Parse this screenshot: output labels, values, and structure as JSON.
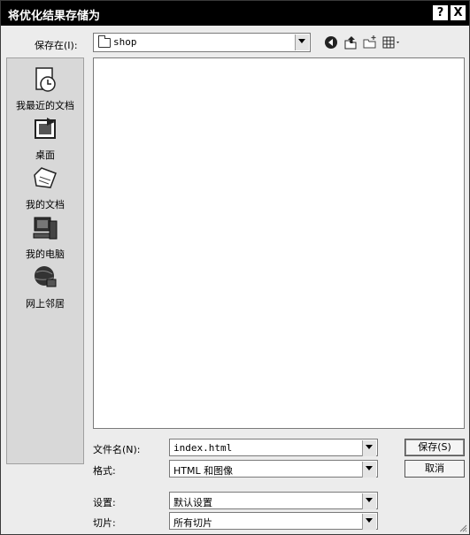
{
  "dialog": {
    "title": "将优化结果存储为",
    "help_button": "?",
    "close_button": "X"
  },
  "lookin": {
    "label": "保存在(I):",
    "value": "shop"
  },
  "toolbar": {
    "icons": [
      "back-icon",
      "up-folder-icon",
      "new-folder-icon",
      "view-menu-icon"
    ]
  },
  "places": [
    {
      "label": "我最近的文档",
      "icon": "recent-documents-icon"
    },
    {
      "label": "桌面",
      "icon": "desktop-icon"
    },
    {
      "label": "我的文档",
      "icon": "my-documents-icon"
    },
    {
      "label": "我的电脑",
      "icon": "my-computer-icon"
    },
    {
      "label": "网上邻居",
      "icon": "network-places-icon"
    }
  ],
  "form": {
    "filename_label": "文件名(N):",
    "filename_value": "index.html",
    "format_label": "格式:",
    "format_value": "HTML 和图像",
    "settings_label": "设置:",
    "settings_value": "默认设置",
    "slices_label": "切片:",
    "slices_value": "所有切片"
  },
  "buttons": {
    "save": "保存(S)",
    "cancel": "取消"
  }
}
